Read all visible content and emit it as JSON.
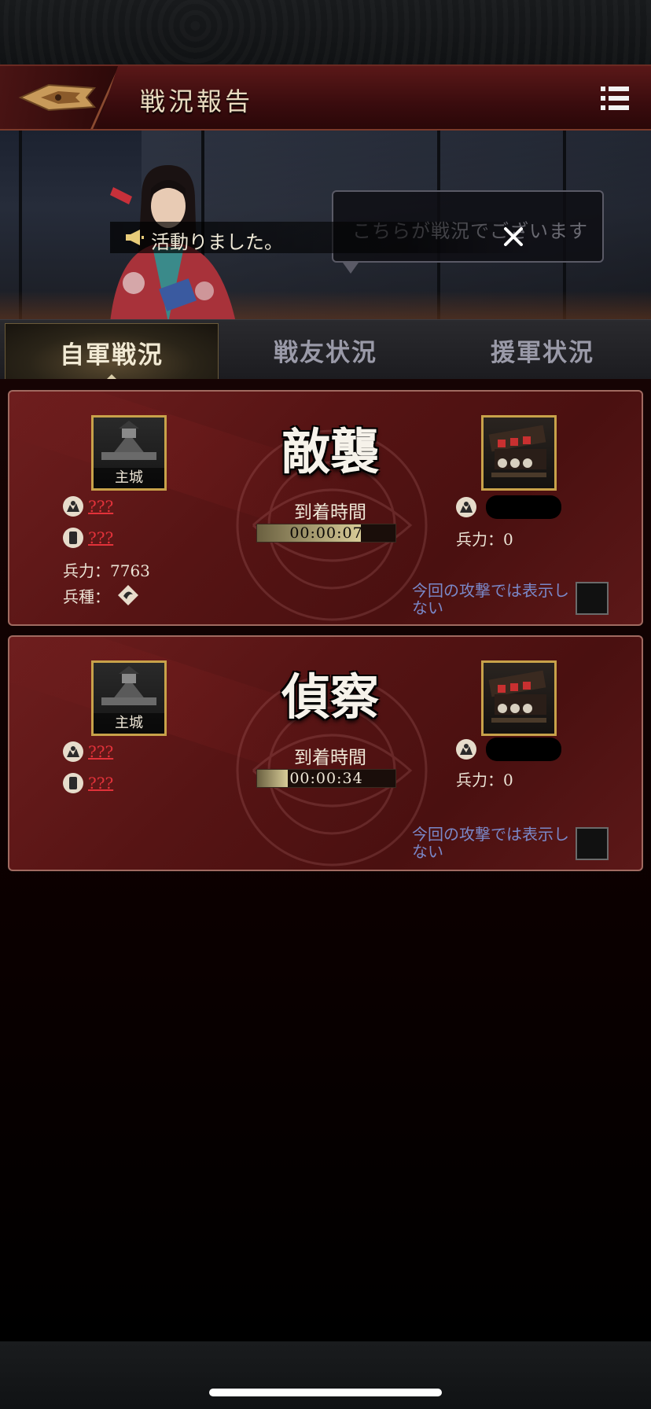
{
  "header": {
    "title": "戦況報告",
    "back_icon": "back-arrow-icon",
    "menu_icon": "list-menu-icon"
  },
  "banner": {
    "notice_text": "活動りました。",
    "speech_text": "こちらが戦況でございます",
    "close_icon": "close-icon"
  },
  "tabs": [
    {
      "label": "自軍戦況",
      "active": true
    },
    {
      "label": "戦友状況",
      "active": false
    },
    {
      "label": "援軍状況",
      "active": false
    }
  ],
  "reports": [
    {
      "action": "敵襲",
      "castle_label": "主城",
      "stat1": "???",
      "stat2": "???",
      "troops_label": "兵力：7763",
      "troop_type_label": "兵種：",
      "arrival_label": "到着時間",
      "timer": "00:00:07",
      "timer_progress": 0.75,
      "enemy_troops": "兵力：0",
      "hide_label": "今回の攻撃では表示しない"
    },
    {
      "action": "偵察",
      "castle_label": "主城",
      "stat1": "???",
      "stat2": "???",
      "arrival_label": "到着時間",
      "timer": "00:00:34",
      "timer_progress": 0.22,
      "enemy_troops": "兵力：0",
      "hide_label": "今回の攻撃では表示しない"
    }
  ],
  "colors": {
    "header_bg": "#3a0c0e",
    "card_bg": "#561414",
    "gold_border": "#c8a24a",
    "unknown_red": "#e2323a",
    "link_blue": "#7a88c8"
  }
}
